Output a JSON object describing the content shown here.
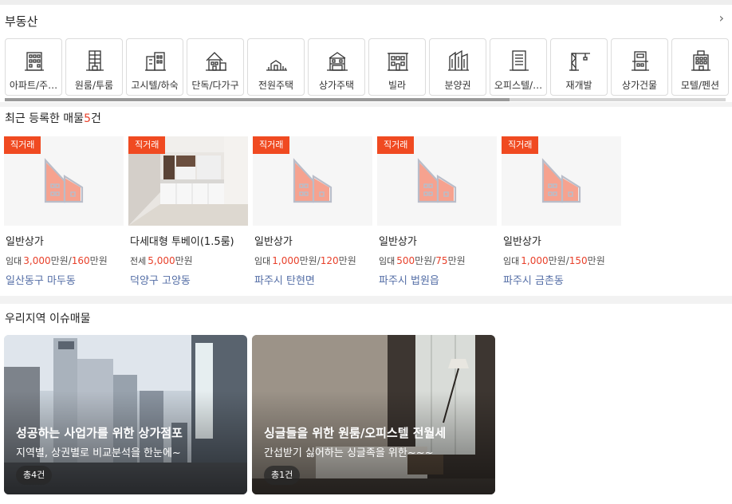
{
  "section_realestate": {
    "title": "부동산",
    "more_icon": "chevron-right-icon",
    "categories": [
      {
        "label": "아파트/주…",
        "icon": "apartment-icon"
      },
      {
        "label": "원룸/투룸",
        "icon": "oneroom-icon"
      },
      {
        "label": "고시텔/하숙",
        "icon": "goshitel-icon"
      },
      {
        "label": "단독/다가구",
        "icon": "house-icon"
      },
      {
        "label": "전원주택",
        "icon": "country-house-icon"
      },
      {
        "label": "상가주택",
        "icon": "shop-house-icon"
      },
      {
        "label": "빌라",
        "icon": "villa-icon"
      },
      {
        "label": "분양권",
        "icon": "presale-icon"
      },
      {
        "label": "오피스텔/…",
        "icon": "officetel-icon"
      },
      {
        "label": "재개발",
        "icon": "redevelopment-icon"
      },
      {
        "label": "상가건물",
        "icon": "commercial-building-icon"
      },
      {
        "label": "모텔/펜션",
        "icon": "motel-icon"
      }
    ],
    "scroll_fraction": 0.7
  },
  "section_recent": {
    "title_prefix": "최근 등록한 매물",
    "count": "5",
    "count_suffix": "건",
    "listings": [
      {
        "badge": "직거래",
        "type": "일반상가",
        "kind": "임대",
        "p1": "3,000",
        "u1": "만원",
        "sep": "/",
        "p2": "160",
        "u2": "만원",
        "loc": "일산동구 마두동",
        "photo": false
      },
      {
        "badge": "직거래",
        "type": "다세대형 투베이(1.5룸)",
        "kind": "전세",
        "p1": "5,000",
        "u1": "만원",
        "sep": "",
        "p2": "",
        "u2": "",
        "loc": "덕양구 고양동",
        "photo": true
      },
      {
        "badge": "직거래",
        "type": "일반상가",
        "kind": "임대",
        "p1": "1,000",
        "u1": "만원",
        "sep": "/",
        "p2": "120",
        "u2": "만원",
        "loc": "파주시 탄현면",
        "photo": false
      },
      {
        "badge": "직거래",
        "type": "일반상가",
        "kind": "임대",
        "p1": "500",
        "u1": "만원",
        "sep": "/",
        "p2": "75",
        "u2": "만원",
        "loc": "파주시 법원읍",
        "photo": false
      },
      {
        "badge": "직거래",
        "type": "일반상가",
        "kind": "임대",
        "p1": "1,000",
        "u1": "만원",
        "sep": "/",
        "p2": "150",
        "u2": "만원",
        "loc": "파주시 금촌동",
        "photo": false
      }
    ]
  },
  "section_issue": {
    "title": "우리지역 이슈매물",
    "cards": [
      {
        "title": "성공하는 사업가를 위한 상가점포",
        "sub": "지역별, 상권별로 비교분석을 한눈에~",
        "total": "총4건"
      },
      {
        "title": "싱글들을 위한 원룸/오피스텔 전월세",
        "sub": "간섭받기 싫어하는 싱글족을 위한~~~",
        "total": "총1건"
      }
    ]
  },
  "colors": {
    "accent": "#f04a21",
    "price": "#e8402a",
    "location": "#546ea6"
  }
}
